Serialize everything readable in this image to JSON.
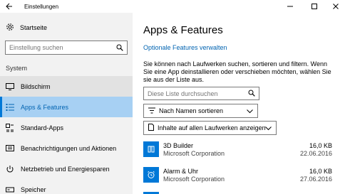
{
  "window": {
    "title": "Einstellungen"
  },
  "sidebar": {
    "home_label": "Startseite",
    "search_placeholder": "Einstellung suchen",
    "section_label": "System",
    "items": [
      {
        "label": "Bildschirm",
        "icon": "monitor-icon"
      },
      {
        "label": "Apps & Features",
        "icon": "apps-list-icon",
        "active": true
      },
      {
        "label": "Standard-Apps",
        "icon": "default-apps-icon"
      },
      {
        "label": "Benachrichtigungen und Aktionen",
        "icon": "notifications-icon"
      },
      {
        "label": "Netzbetrieb und Energiesparen",
        "icon": "power-icon"
      },
      {
        "label": "Speicher",
        "icon": "storage-icon"
      }
    ]
  },
  "main": {
    "title": "Apps & Features",
    "optional_link": "Optionale Features verwalten",
    "description": "Sie können nach Laufwerken suchen, sortieren und filtern. Wenn Sie eine App deinstallieren oder verschieben möchten, wählen Sie sie aus der Liste aus.",
    "list_search_placeholder": "Diese Liste durchsuchen",
    "sort_label": "Nach Namen sortieren",
    "drive_label": "Inhalte auf allen Laufwerken anzeigen",
    "apps": [
      {
        "name": "3D Builder",
        "publisher": "Microsoft Corporation",
        "size": "16,0 KB",
        "date": "22.06.2016",
        "icon": "3d-builder-icon"
      },
      {
        "name": "Alarm & Uhr",
        "publisher": "Microsoft Corporation",
        "size": "16,0 KB",
        "date": "27.06.2016",
        "icon": "alarm-clock-icon"
      }
    ]
  },
  "colors": {
    "accent": "#0078d7",
    "link": "#0063b1",
    "selected_bg": "#a7d0f3",
    "sidebar_bg": "#f2f2f2"
  }
}
